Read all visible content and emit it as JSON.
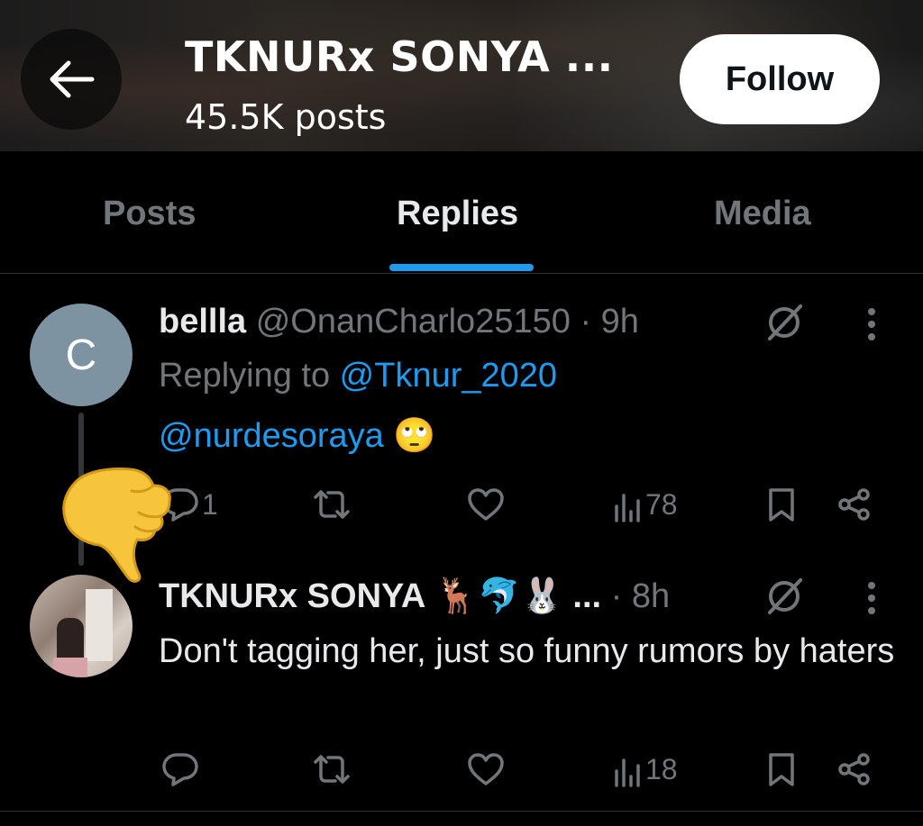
{
  "header": {
    "title": "TKNURx SONYA ...",
    "posts_count": "45.5K posts",
    "follow_label": "Follow"
  },
  "tabs": [
    {
      "label": "Posts",
      "active": false
    },
    {
      "label": "Replies",
      "active": true
    },
    {
      "label": "Media",
      "active": false
    }
  ],
  "posts": [
    {
      "avatar_letter": "C",
      "name": "bellla",
      "handle": "@OnanCharlo25150",
      "dot": "·",
      "time": "9h",
      "replying_prefix": "Replying to ",
      "replying_to": "@Tknur_2020",
      "mention": "@nurdesoraya",
      "emoji": "🙄",
      "replies": "1",
      "views": "78"
    },
    {
      "name": "TKNURx SONYA",
      "name_emojis": "🦌🐬🐰",
      "ellipsis": "...",
      "dot": "·",
      "time": "8h",
      "body": "Don't tagging her, just so funny rumors by haters",
      "views": "18"
    }
  ],
  "colors": {
    "accent": "#1d9bf0",
    "muted": "#71767b",
    "text": "#e7e9ea",
    "background": "#000000"
  },
  "icons": [
    "back-arrow-icon",
    "grok-icon",
    "more-icon",
    "reply-icon",
    "repost-icon",
    "like-icon",
    "views-icon",
    "bookmark-icon",
    "share-icon",
    "thumbs-down-emoji"
  ]
}
